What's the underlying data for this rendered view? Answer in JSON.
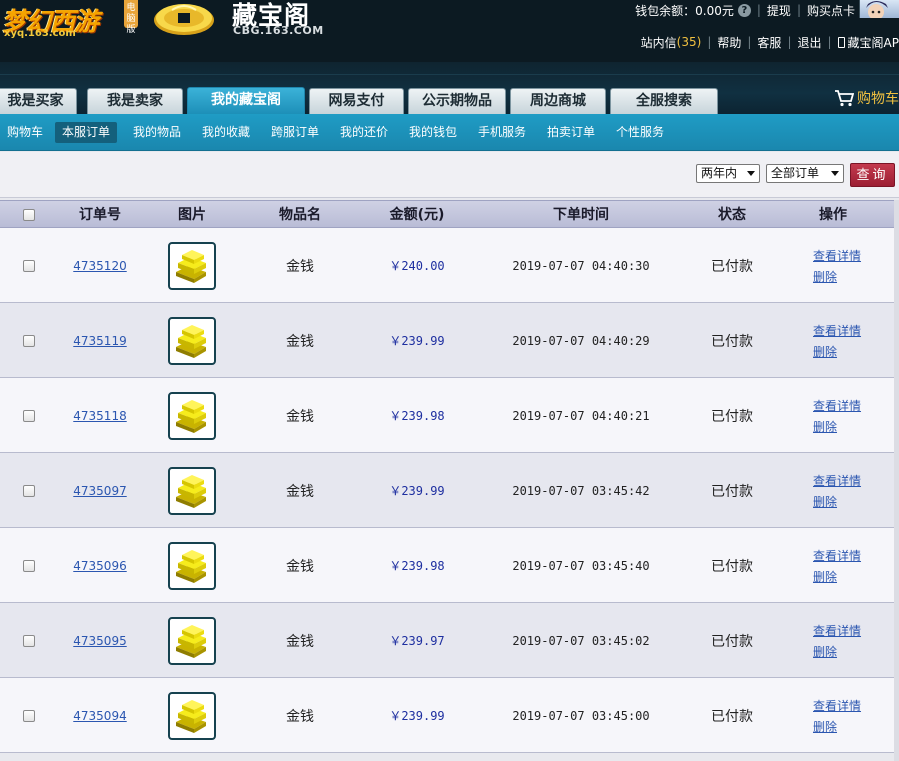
{
  "header": {
    "xyq_logo_text": "梦幻西游",
    "xyq_badge": "电脑版",
    "xyq_url": "xyq.163.com",
    "cbg_title": "藏宝阁",
    "cbg_url": "CBG.163.COM",
    "wallet_label": "钱包余额：",
    "wallet_value": "0.00元",
    "withdraw": "提现",
    "buy_card": "购买点卡",
    "inbox_label": "站内信",
    "inbox_count": "(35)",
    "help": "帮助",
    "service": "客服",
    "logout": "退出",
    "app": "藏宝阁AP"
  },
  "main_tabs": [
    {
      "label": "我是买家"
    },
    {
      "label": "我是卖家"
    },
    {
      "label": "我的藏宝阁",
      "active": true
    },
    {
      "label": "网易支付"
    },
    {
      "label": "公示期物品"
    },
    {
      "label": "周边商城"
    },
    {
      "label": "全服搜索"
    }
  ],
  "cart_label": "购物车",
  "sub_nav": [
    {
      "label": "购物车"
    },
    {
      "label": "本服订单",
      "active": true
    },
    {
      "label": "我的物品"
    },
    {
      "label": "我的收藏"
    },
    {
      "label": "跨服订单"
    },
    {
      "label": "我的还价"
    },
    {
      "label": "我的钱包"
    },
    {
      "label": "手机服务"
    },
    {
      "label": "拍卖订单"
    },
    {
      "label": "个性服务"
    }
  ],
  "filters": {
    "time_range": "两年内",
    "order_type": "全部订单",
    "query_button": "查询"
  },
  "table": {
    "headers": [
      "订单号",
      "图片",
      "物品名",
      "金额(元)",
      "下单时间",
      "状态",
      "操作"
    ],
    "rows": [
      {
        "order_id": "4735120",
        "item": "金钱",
        "amount": "￥240.00",
        "time": "2019-07-07 04:40:30",
        "status": "已付款",
        "view": "查看详情",
        "delete": "删除"
      },
      {
        "order_id": "4735119",
        "item": "金钱",
        "amount": "￥239.99",
        "time": "2019-07-07 04:40:29",
        "status": "已付款",
        "view": "查看详情",
        "delete": "删除"
      },
      {
        "order_id": "4735118",
        "item": "金钱",
        "amount": "￥239.98",
        "time": "2019-07-07 04:40:21",
        "status": "已付款",
        "view": "查看详情",
        "delete": "删除"
      },
      {
        "order_id": "4735097",
        "item": "金钱",
        "amount": "￥239.99",
        "time": "2019-07-07 03:45:42",
        "status": "已付款",
        "view": "查看详情",
        "delete": "删除"
      },
      {
        "order_id": "4735096",
        "item": "金钱",
        "amount": "￥239.98",
        "time": "2019-07-07 03:45:40",
        "status": "已付款",
        "view": "查看详情",
        "delete": "删除"
      },
      {
        "order_id": "4735095",
        "item": "金钱",
        "amount": "￥239.97",
        "time": "2019-07-07 03:45:02",
        "status": "已付款",
        "view": "查看详情",
        "delete": "删除"
      },
      {
        "order_id": "4735094",
        "item": "金钱",
        "amount": "￥239.99",
        "time": "2019-07-07 03:45:00",
        "status": "已付款",
        "view": "查看详情",
        "delete": "删除"
      }
    ]
  },
  "colors": {
    "header_bg": "#0c1a22",
    "tab_active": "#1d8fb8",
    "subnav_bg": "#1f9cc5",
    "query_button": "#9b1e33",
    "link": "#2b56b0",
    "price": "#1e2fa0",
    "accent_gold": "#f0c040"
  },
  "icons": {
    "wallet_help": "question-icon",
    "cart": "shopping-cart-icon",
    "app": "phone-icon",
    "item_thumb": "gold-bars-icon"
  }
}
